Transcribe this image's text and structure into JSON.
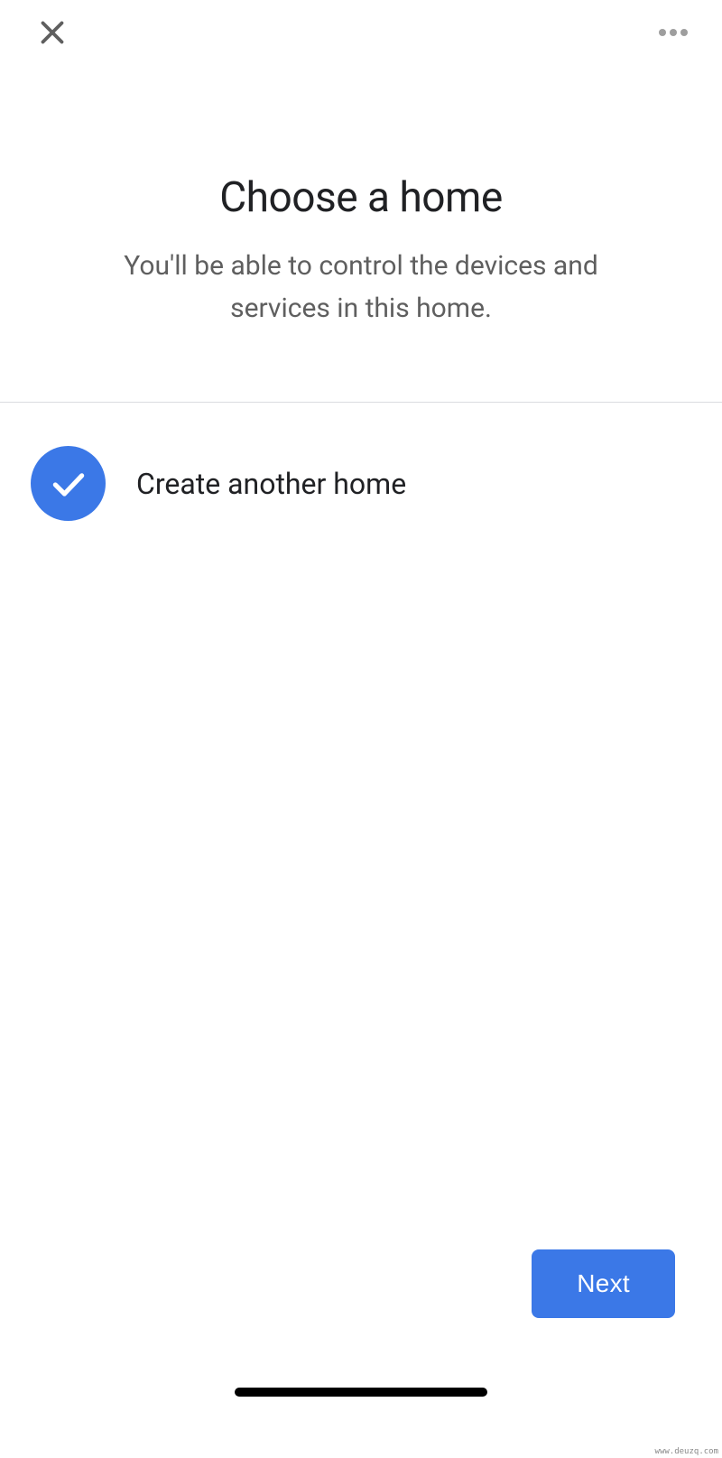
{
  "header": {
    "title": "Choose a home",
    "subtitle": "You'll be able to control the devices and services in this home."
  },
  "options": [
    {
      "label": "Create another home",
      "selected": true
    }
  ],
  "actions": {
    "next_label": "Next"
  },
  "watermark": "www.deuzq.com",
  "colors": {
    "primary": "#3b78e7",
    "text_primary": "#202124",
    "text_secondary": "#5f5f5f"
  }
}
